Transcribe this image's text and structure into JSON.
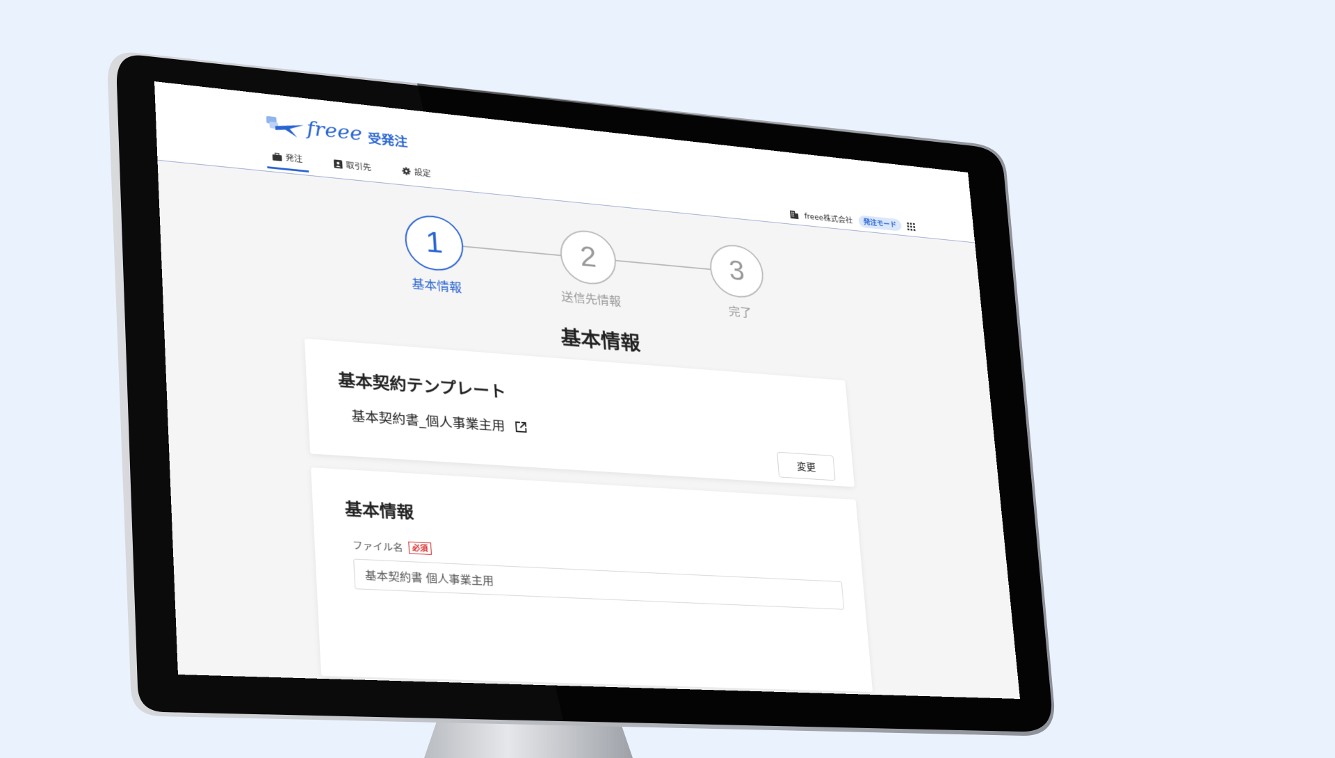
{
  "header": {
    "brand": "freee",
    "product": "受発注",
    "nav": [
      {
        "label": "発注",
        "icon": "briefcase-icon"
      },
      {
        "label": "取引先",
        "icon": "contact-book-icon"
      },
      {
        "label": "設定",
        "icon": "gear-icon"
      }
    ],
    "company": "freee株式会社",
    "mode": "発注モード"
  },
  "stepper": {
    "steps": [
      {
        "number": "1",
        "label": "基本情報"
      },
      {
        "number": "2",
        "label": "送信先情報"
      },
      {
        "number": "3",
        "label": "完了"
      }
    ],
    "active_step": 1
  },
  "page_title": "基本情報",
  "template_card": {
    "title": "基本契約テンプレート",
    "template_name": "基本契約書_個人事業主用",
    "change_label": "変更"
  },
  "basic_card": {
    "title": "基本情報",
    "file_label": "ファイル名",
    "required_label": "必須",
    "file_value": "基本契約書 個人事業主用"
  },
  "colors": {
    "accent": "#2864d2",
    "required": "#d42a2a",
    "background": "#eaf2fd"
  }
}
